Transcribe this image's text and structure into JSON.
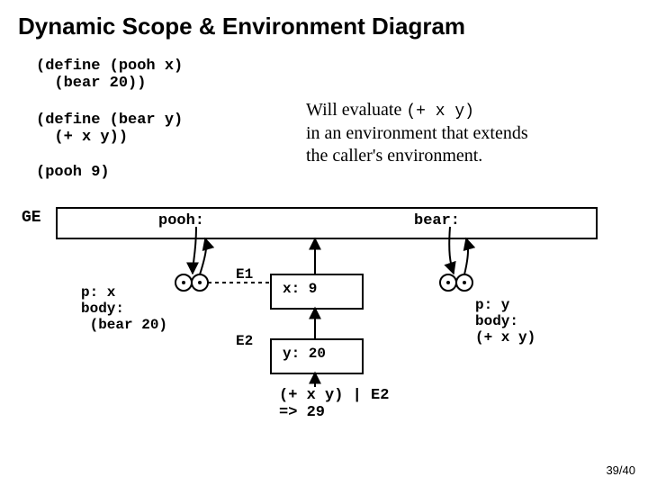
{
  "title": "Dynamic Scope & Environment Diagram",
  "code": {
    "define_pooh": "(define (pooh x)\n  (bear 20))",
    "define_bear": "(define (bear y)\n  (+ x y))",
    "call": "(pooh 9)"
  },
  "explain": {
    "line1_prefix": "Will evaluate ",
    "line1_code": "(+ x y)",
    "line2": "in an environment that extends",
    "line3": "the caller's environment."
  },
  "env": {
    "ge_label": "GE",
    "pooh_label": "pooh:",
    "bear_label": "bear:",
    "pooh_detail": "p: x\nbody:\n (bear 20)",
    "bear_detail": "p: y\nbody:\n(+ x y)",
    "e1_label": "E1",
    "e1_content": "x: 9",
    "e2_label": "E2",
    "e2_content": "y: 20"
  },
  "result": "(+ x y) | E2\n=> 29",
  "pagenum": "39/40"
}
